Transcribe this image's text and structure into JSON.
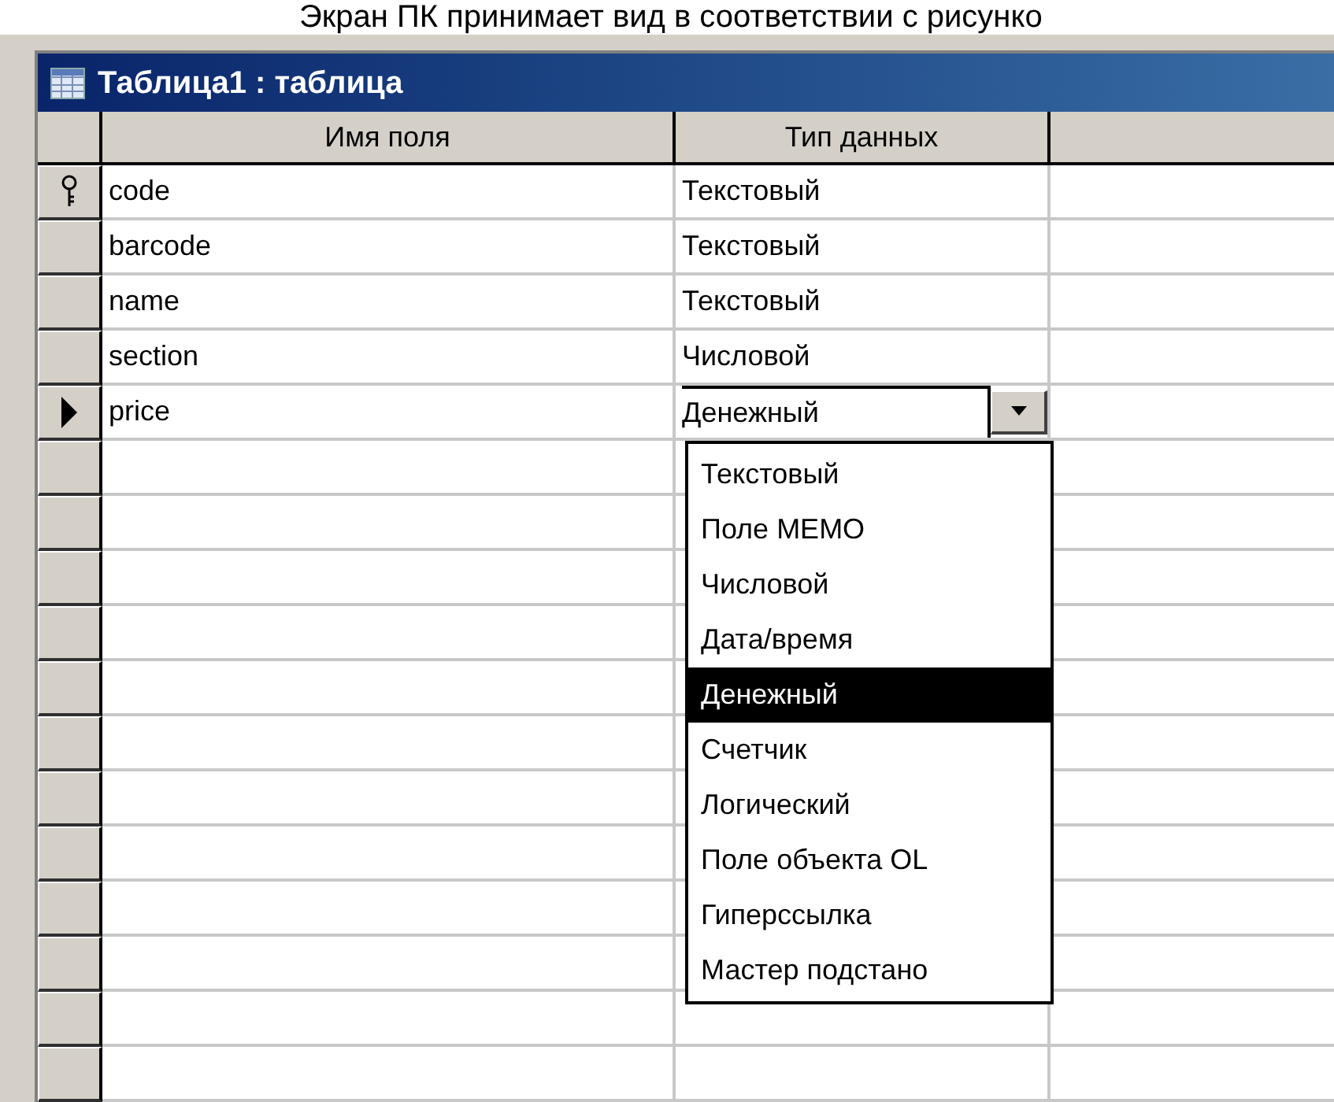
{
  "caption": "Экран ПК принимает вид в соответствии с рисунко",
  "window": {
    "title": "Таблица1 : таблица"
  },
  "table": {
    "columns": [
      "Имя поля",
      "Тип данных"
    ],
    "rows": [
      {
        "field": "code",
        "type": "Текстовый",
        "key": true,
        "current": false
      },
      {
        "field": "barcode",
        "type": "Текстовый",
        "key": false,
        "current": false
      },
      {
        "field": "name",
        "type": "Текстовый",
        "key": false,
        "current": false
      },
      {
        "field": "section",
        "type": "Числовой",
        "key": false,
        "current": false
      },
      {
        "field": "price",
        "type": "Денежный",
        "key": false,
        "current": true
      }
    ]
  },
  "type_list": {
    "options": [
      {
        "label": "Текстовый",
        "selected": false
      },
      {
        "label": "Поле MEMO",
        "selected": false
      },
      {
        "label": "Числовой",
        "selected": false
      },
      {
        "label": "Дата/время",
        "selected": false
      },
      {
        "label": "Денежный",
        "selected": true
      },
      {
        "label": "Счетчик",
        "selected": false
      },
      {
        "label": "Логический",
        "selected": false
      },
      {
        "label": "Поле объекта OL",
        "selected": false
      },
      {
        "label": "Гиперссылка",
        "selected": false
      },
      {
        "label": "Мастер подстано",
        "selected": false
      }
    ]
  }
}
